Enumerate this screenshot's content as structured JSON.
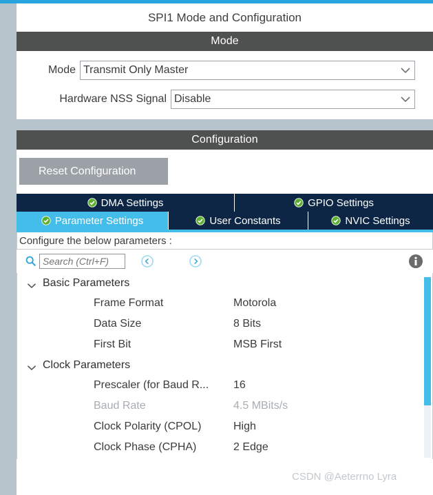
{
  "header": {
    "title": "SPI1 Mode and Configuration"
  },
  "mode_section": {
    "header": "Mode",
    "fields": [
      {
        "label": "Mode",
        "value": "Transmit Only Master",
        "icon": "chevron-down-icon"
      },
      {
        "label": "Hardware NSS Signal",
        "value": "Disable",
        "icon": "chevron-down-icon"
      }
    ]
  },
  "configuration_section": {
    "header": "Configuration",
    "reset_button": "Reset Configuration",
    "tabs_row1": [
      {
        "label": "DMA Settings",
        "active": false,
        "status_icon": "check-circle-icon"
      },
      {
        "label": "GPIO Settings",
        "active": false,
        "status_icon": "check-circle-icon"
      }
    ],
    "tabs_row2": [
      {
        "label": "Parameter Settings",
        "active": true,
        "status_icon": "check-circle-icon"
      },
      {
        "label": "User Constants",
        "active": false,
        "status_icon": "check-circle-icon"
      },
      {
        "label": "NVIC Settings",
        "active": false,
        "status_icon": "check-circle-icon"
      }
    ],
    "note": "Configure the below parameters :",
    "toolbar": {
      "search_placeholder": "Search (Ctrl+F)",
      "search_value": "",
      "search_icon": "search-icon",
      "prev_icon": "circle-left-arrow-icon",
      "next_icon": "circle-right-arrow-icon",
      "info_icon": "info-circle-icon"
    },
    "parameter_groups": [
      {
        "label": "Basic Parameters",
        "expanded": true,
        "twisty_icon": "chevron-down-icon",
        "parameters": [
          {
            "name": "Frame Format",
            "value": "Motorola",
            "disabled": false
          },
          {
            "name": "Data Size",
            "value": "8 Bits",
            "disabled": false
          },
          {
            "name": "First Bit",
            "value": "MSB First",
            "disabled": false
          }
        ]
      },
      {
        "label": "Clock Parameters",
        "expanded": true,
        "twisty_icon": "chevron-down-icon",
        "parameters": [
          {
            "name": "Prescaler (for Baud R...",
            "value": "16",
            "disabled": false
          },
          {
            "name": "Baud Rate",
            "value": "4.5 MBits/s",
            "disabled": true
          },
          {
            "name": "Clock Polarity (CPOL)",
            "value": "High",
            "disabled": false
          },
          {
            "name": "Clock Phase (CPHA)",
            "value": "2 Edge",
            "disabled": false
          }
        ]
      }
    ]
  },
  "watermark": "CSDN @Aeterrno Lyra",
  "colors": {
    "accent_blue": "#27a4dd",
    "tab_active": "#45bdea",
    "tab_inactive": "#0d2646",
    "section_header": "#4f5150",
    "check_green": "#5bb030"
  }
}
